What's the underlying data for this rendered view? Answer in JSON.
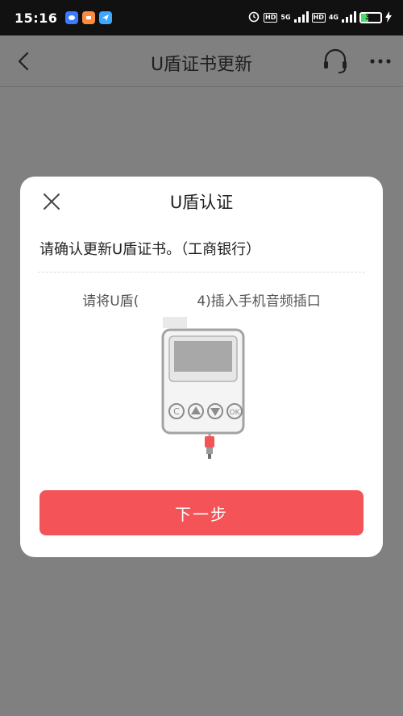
{
  "status_bar": {
    "time": "15:16",
    "app_icons": [
      {
        "name": "chat-app-icon",
        "color": "#3b7bff"
      },
      {
        "name": "news-app-icon",
        "color": "#ff8a3c"
      },
      {
        "name": "send-app-icon",
        "color": "#3ea8ff"
      }
    ],
    "hd_label": "HD",
    "net_5g_label": "5G",
    "net_4g_label": "4G",
    "battery_percent": "39",
    "battery_level": 0.39,
    "battery_color": "#4cd964"
  },
  "header": {
    "title": "U盾证书更新",
    "back_icon": "chevron-left-icon",
    "service_icon": "headset-icon",
    "more_icon": "more-dots-icon"
  },
  "modal": {
    "title": "U盾认证",
    "close_icon": "close-icon",
    "confirm_text": "请确认更新U盾证书。（工商银行）",
    "instruction_prefix": "请将U盾(",
    "instruction_suffix": "4)插入手机音频插口",
    "device_image": "usb-token-icon",
    "token_buttons": [
      "C",
      "▲",
      "▼",
      "OK"
    ],
    "next_button_label": "下一步",
    "accent_color": "#f45357"
  }
}
